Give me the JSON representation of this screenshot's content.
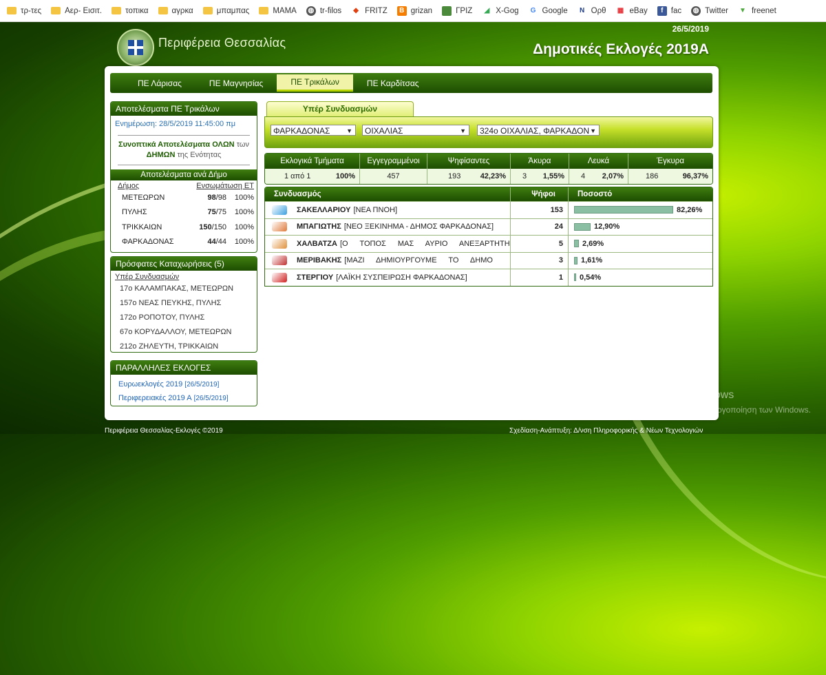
{
  "bookmarks": [
    {
      "label": "τρ-τες",
      "icon": "folder-icon"
    },
    {
      "label": "Αερ- Εισιτ.",
      "icon": "folder-icon"
    },
    {
      "label": "τοπικα",
      "icon": "folder-icon"
    },
    {
      "label": "αγρκα",
      "icon": "folder-icon"
    },
    {
      "label": "μπαμπας",
      "icon": "folder-icon"
    },
    {
      "label": "ΜΑΜΑ",
      "icon": "folder-icon"
    },
    {
      "label": "tr-filos",
      "icon": "globe-icon"
    },
    {
      "label": "FRITZ",
      "icon": "fritz-icon"
    },
    {
      "label": "grizan",
      "icon": "blogger-icon"
    },
    {
      "label": "ΓΡΙΖ",
      "icon": "image-icon"
    },
    {
      "label": "X-Gog",
      "icon": "maps-icon"
    },
    {
      "label": "Google",
      "icon": "google-icon"
    },
    {
      "label": "Ορθ",
      "icon": "n-icon"
    },
    {
      "label": "eBay",
      "icon": "ebay-icon"
    },
    {
      "label": "fac",
      "icon": "facebook-icon"
    },
    {
      "label": "Twitter",
      "icon": "globe-icon"
    },
    {
      "label": "freenet",
      "icon": "freenet-icon"
    }
  ],
  "header": {
    "region": "Περιφέρεια Θεσσαλίας",
    "date": "26/5/2019",
    "title": "Δημοτικές Εκλογές 2019Α"
  },
  "nav_tabs": [
    "ΠΕ Λάρισας",
    "ΠΕ Μαγνησίας",
    "ΠΕ Τρικάλων",
    "ΠΕ Καρδίτσας"
  ],
  "nav_active": "ΠΕ Τρικάλων",
  "results_box": {
    "title": "Αποτελέσματα ΠΕ Τρικάλων",
    "updated": "Ενημέρωση: 28/5/2019 11:45:00 πμ",
    "summary_link": "Συνοπτικά Αποτελέσματα ΟΛΩΝ",
    "summary_twn": "των",
    "summary_link2": "ΔΗΜΩΝ",
    "summary_rest": "της Ενότητας",
    "per_dimo_header": "Αποτελέσματα ανά Δήμο",
    "col_dimos": "Δήμος",
    "col_ensomatosi": "Ενσωμάτωση ΕΤ",
    "rows": [
      {
        "name": "ΜΕΤΕΩΡΩΝ",
        "done": "98",
        "total": "/98",
        "pct": "100%"
      },
      {
        "name": "ΠΥΛΗΣ",
        "done": "75",
        "total": "/75",
        "pct": "100%"
      },
      {
        "name": "ΤΡΙΚΚΑΙΩΝ",
        "done": "150",
        "total": "/150",
        "pct": "100%"
      },
      {
        "name": "ΦΑΡΚΑΔΟΝΑΣ",
        "done": "44",
        "total": "/44",
        "pct": "100%"
      }
    ]
  },
  "recent_box": {
    "title": "Πρόσφατες Καταχωρήσεις (5)",
    "subtitle": "Υπέρ Συνδυασμών",
    "items": [
      "17ο ΚΑΛΑΜΠΑΚΑΣ, ΜΕΤΕΩΡΩΝ",
      "157ο ΝΕΑΣ ΠΕΥΚΗΣ, ΠΥΛΗΣ",
      "172ο ΡΟΠΟΤΟΥ, ΠΥΛΗΣ",
      "67ο ΚΟΡΥΔΑΛΛΟΥ, ΜΕΤΕΩΡΩΝ",
      "212ο ΖΗΛΕΥΤΗ, ΤΡΙΚΚΑΙΩΝ"
    ]
  },
  "parallel_box": {
    "title": "ΠΑΡΑΛΛΗΛΕΣ ΕΚΛΟΓΕΣ",
    "items": [
      {
        "label": "Ευρωεκλογές 2019",
        "date": "[26/5/2019]"
      },
      {
        "label": "Περιφερειακές 2019 Α",
        "date": "[26/5/2019]"
      }
    ]
  },
  "filter": {
    "tab_label": "Υπέρ Συνδυασμών",
    "select1": "ΦΑΡΚΑΔΟΝΑΣ",
    "select2": "ΟΙΧΑΛΙΑΣ",
    "select3": "324ο ΟΙΧΑΛΙΑΣ, ΦΑΡΚΑΔΟΝ"
  },
  "stats": {
    "headers": [
      "Εκλογικά Τμήματα",
      "Εγγεγραμμένοι",
      "Ψηφίσαντες",
      "Άκυρα",
      "Λευκά",
      "Έγκυρα"
    ],
    "tmimata": "1 από 1",
    "tmimata_pct": "100%",
    "eggegrammenoi": "457",
    "psifisantes": "193",
    "psifisantes_pct": "42,23%",
    "akyra": "3",
    "akyra_pct": "1,55%",
    "leyka": "4",
    "leyka_pct": "2,07%",
    "egkyra": "186",
    "egkyra_pct": "96,37%"
  },
  "results": {
    "headers": [
      "Συνδυασμός",
      "Ψήφοι",
      "Ποσοστό"
    ],
    "rows": [
      {
        "candidate": "ΣΑΚΕΛΛΑΡΙΟΥ",
        "party": "[ΝΕΑ ΠΝΟΗ]",
        "votes": "153",
        "pct": "82,26%",
        "share": 0.8226,
        "logo_color": "#3aa0e0"
      },
      {
        "candidate": "ΜΠΑΓΙΩΤΗΣ",
        "party": "[ΝΕΟ ΞΕΚΙΝΗΜΑ - ΔΗΜΟΣ ΦΑΡΚΑΔΟΝΑΣ]",
        "votes": "24",
        "pct": "12,90%",
        "share": 0.129,
        "logo_color": "#e07a3a"
      },
      {
        "candidate": "ΧΑΛΒΑΤΖΑ",
        "party": "[Ο ΤΟΠΟΣ ΜΑΣ ΑΥΡΙΟ ΑΝΕΞΑΡΤΗΤΗ",
        "votes": "5",
        "pct": "2,69%",
        "share": 0.0269,
        "logo_color": "#e0903a"
      },
      {
        "candidate": "ΜΕΡΙΒΑΚΗΣ",
        "party": "[ΜΑΖΙ ΔΗΜΙΟΥΡΓΟΥΜΕ ΤΟ ΔΗΜΟ",
        "votes": "3",
        "pct": "1,61%",
        "share": 0.0161,
        "logo_color": "#c03030"
      },
      {
        "candidate": "ΣΤΕΡΓΙΟΥ",
        "party": "[ΛΑΪΚΗ ΣΥΣΠΕΙΡΩΣΗ ΦΑΡΚΑΔΟΝΑΣ]",
        "votes": "1",
        "pct": "0,54%",
        "share": 0.0054,
        "logo_color": "#d02020"
      }
    ]
  },
  "footer": {
    "left": "Περιφέρεια Θεσσαλίας-Εκλογές ©2019",
    "right": "Σχεδίαση-Ανάπτυξη: Δ/νση Πληροφορικής & Νέων Τεχνολογιών"
  },
  "windows_watermark": {
    "title": "Ενεργοποιήστε τα Windows",
    "sub": "Μετάβαση στις ρυθμίσεις για ενεργοποίηση των Windows."
  }
}
